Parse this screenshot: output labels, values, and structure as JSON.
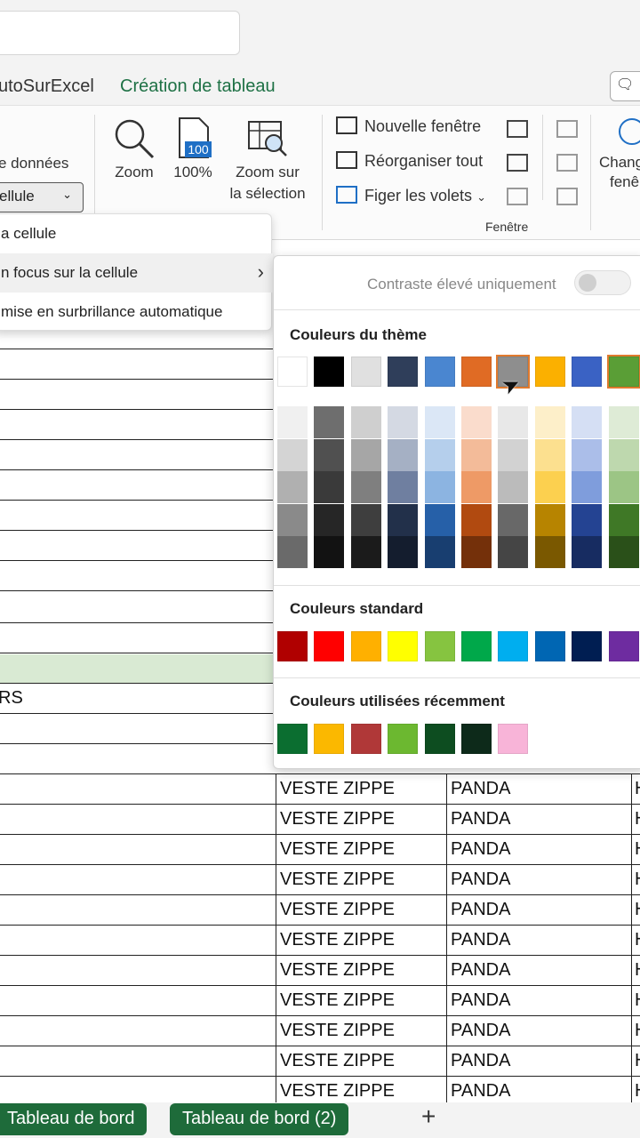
{
  "tabs": {
    "autosurexcel": "utoSurExcel",
    "creation": "Création de tableau"
  },
  "ribbon": {
    "donnees_label": "e données",
    "cellule_dropdown": "ellule",
    "zoom": "Zoom",
    "zoom100": "100%",
    "zoom_sel_1": "Zoom sur",
    "zoom_sel_2": "la sélection",
    "zoom100_badge": "100",
    "nouvelle_fenetre": "Nouvelle fenêtre",
    "reorganiser": "Réorganiser tout",
    "figer": "Figer les volets",
    "fenetre_group": "Fenêtre",
    "change_1": "Chang",
    "change_2": "fenê"
  },
  "context_menu": {
    "item1": "a cellule",
    "item2": "n focus sur la cellule",
    "item3": "mise en surbrillance automatique"
  },
  "color_panel": {
    "contrast_label": "Contraste élevé uniquement",
    "theme_title": "Couleurs du thème",
    "standard_title": "Couleurs standard",
    "recent_title": "Couleurs utilisées récemment",
    "theme_colors": [
      "#ffffff",
      "#000000",
      "#e0e0e0",
      "#2f3e5a",
      "#4a86d0",
      "#e06b24",
      "#8e8e8e",
      "#fbb000",
      "#3a62c4",
      "#5a9e36"
    ],
    "theme_shades": [
      [
        "#f0f0f0",
        "#d4d4d4",
        "#b0b0b0",
        "#8a8a8a",
        "#6a6a6a"
      ],
      [
        "#6e6e6e",
        "#505050",
        "#3a3a3a",
        "#262626",
        "#121212"
      ],
      [
        "#cfcfcf",
        "#a6a6a6",
        "#7f7f7f",
        "#3e3e3e",
        "#1b1b1b"
      ],
      [
        "#d4d9e3",
        "#a5b0c4",
        "#6f7fa0",
        "#22304a",
        "#141d2e"
      ],
      [
        "#dbe7f6",
        "#b5cfec",
        "#8cb4e1",
        "#2660a8",
        "#183e70"
      ],
      [
        "#fadccc",
        "#f3bb99",
        "#ee9a66",
        "#b14a10",
        "#74300a"
      ],
      [
        "#e8e8e8",
        "#d2d2d2",
        "#bbbbbb",
        "#686868",
        "#454545"
      ],
      [
        "#fdefc9",
        "#fce08f",
        "#fcd04f",
        "#b78400",
        "#7a5800"
      ],
      [
        "#d5dff4",
        "#abbee9",
        "#7f9ddc",
        "#244392",
        "#172c61"
      ],
      [
        "#deebd6",
        "#bed8ae",
        "#9cc585",
        "#3f7826",
        "#2a5019"
      ]
    ],
    "standard_colors": [
      "#b00000",
      "#ff0000",
      "#ffb000",
      "#ffff00",
      "#86c440",
      "#00a84a",
      "#00aeef",
      "#0066b3",
      "#001e52",
      "#6e2ca0"
    ],
    "recent_colors": [
      "#0b6e30",
      "#fbb800",
      "#b03838",
      "#6cb830",
      "#0d4d20",
      "#0d2a1a",
      "#f8b4d8"
    ],
    "selected_theme_index": 6
  },
  "sheet": {
    "rs_text": "RS",
    "rows": [
      {
        "col_b": "VESTE ZIPPE",
        "col_c": "PANDA",
        "col_d": "H"
      },
      {
        "col_b": "VESTE ZIPPE",
        "col_c": "PANDA",
        "col_d": "H"
      },
      {
        "col_b": "VESTE ZIPPE",
        "col_c": "PANDA",
        "col_d": "H"
      },
      {
        "col_b": "VESTE ZIPPE",
        "col_c": "PANDA",
        "col_d": "H"
      },
      {
        "col_b": "VESTE ZIPPE",
        "col_c": "PANDA",
        "col_d": "H"
      },
      {
        "col_b": "VESTE ZIPPE",
        "col_c": "PANDA",
        "col_d": "H"
      },
      {
        "col_b": "VESTE ZIPPE",
        "col_c": "PANDA",
        "col_d": "H"
      },
      {
        "col_b": "VESTE ZIPPE",
        "col_c": "PANDA",
        "col_d": "H"
      },
      {
        "col_b": "VESTE ZIPPE",
        "col_c": "PANDA",
        "col_d": "H"
      },
      {
        "col_b": "VESTE ZIPPE",
        "col_c": "PANDA",
        "col_d": "H"
      },
      {
        "col_b": "VESTE ZIPPE",
        "col_c": "PANDA",
        "col_d": "H"
      }
    ]
  },
  "sheet_tabs": {
    "tab1": "Tableau de bord",
    "tab2": "Tableau de bord (2)",
    "add": "+"
  },
  "icons": {
    "comment": "comment-icon",
    "zoom": "magnifier-icon",
    "zoom100": "page-100-icon",
    "zoom_selection": "zoom-selection-icon",
    "chevron": "chevron-down-icon",
    "submenu": "chevron-right-icon"
  }
}
